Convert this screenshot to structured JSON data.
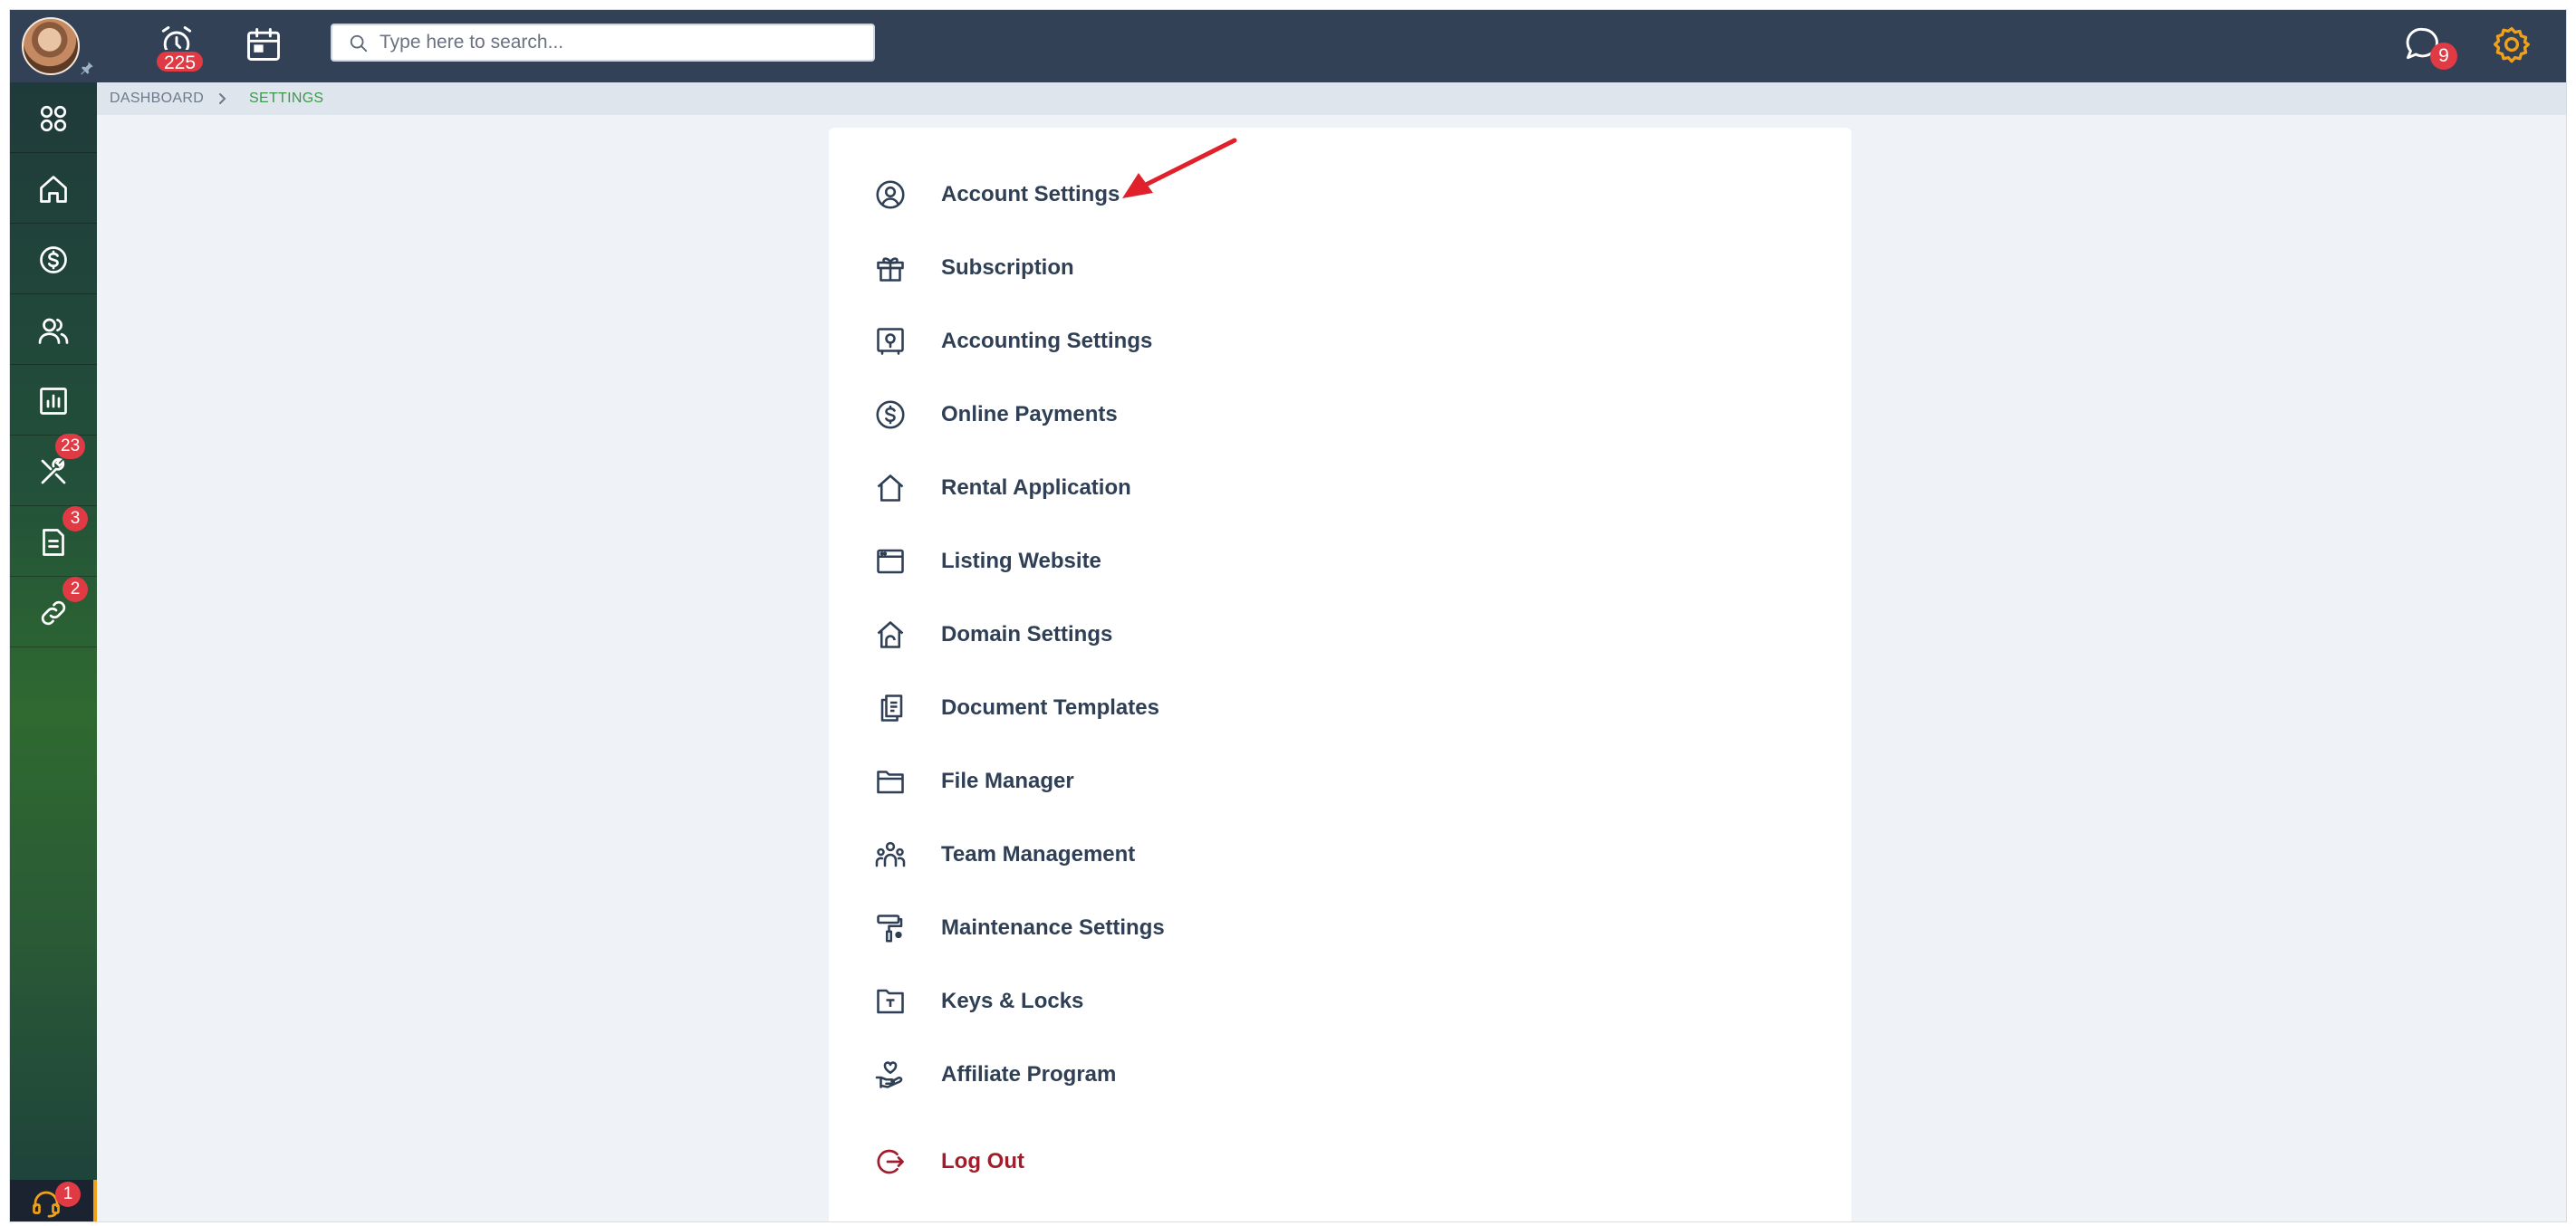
{
  "topbar": {
    "alarm_badge": "225",
    "search_placeholder": "Type here to search...",
    "chat_badge": "9"
  },
  "sidebar": {
    "items": [
      {
        "icon": "apps-grid-icon",
        "badge": ""
      },
      {
        "icon": "home-icon",
        "badge": ""
      },
      {
        "icon": "dollar-circle-icon",
        "badge": ""
      },
      {
        "icon": "people-icon",
        "badge": ""
      },
      {
        "icon": "bar-chart-icon",
        "badge": ""
      },
      {
        "icon": "tools-icon",
        "badge": "23"
      },
      {
        "icon": "document-icon",
        "badge": "3"
      },
      {
        "icon": "link-icon",
        "badge": "2"
      }
    ],
    "support_badge": "1"
  },
  "breadcrumb": {
    "dashboard": "DASHBOARD",
    "current": "SETTINGS"
  },
  "settings_menu": [
    {
      "label": "Account Settings",
      "icon": "user-circle-icon"
    },
    {
      "label": "Subscription",
      "icon": "gift-icon"
    },
    {
      "label": "Accounting Settings",
      "icon": "safe-icon"
    },
    {
      "label": "Online Payments",
      "icon": "dollar-circle-icon"
    },
    {
      "label": "Rental Application",
      "icon": "home-icon"
    },
    {
      "label": "Listing Website",
      "icon": "browser-window-icon"
    },
    {
      "label": "Domain Settings",
      "icon": "house-domain-icon"
    },
    {
      "label": "Document Templates",
      "icon": "documents-icon"
    },
    {
      "label": "File Manager",
      "icon": "folder-icon"
    },
    {
      "label": "Team Management",
      "icon": "team-icon"
    },
    {
      "label": "Maintenance Settings",
      "icon": "paint-roller-icon"
    },
    {
      "label": "Keys & Locks",
      "icon": "key-folder-icon"
    },
    {
      "label": "Affiliate Program",
      "icon": "hand-heart-icon"
    },
    {
      "label": "Log Out",
      "icon": "logout-icon"
    }
  ],
  "colors": {
    "topbar": "#334157",
    "accent_orange": "#f0a11a",
    "badge_red": "#e03a44",
    "breadcrumb_active": "#3a9a4a",
    "logout_red": "#a11d2b",
    "annotation_arrow": "#e0202a"
  }
}
